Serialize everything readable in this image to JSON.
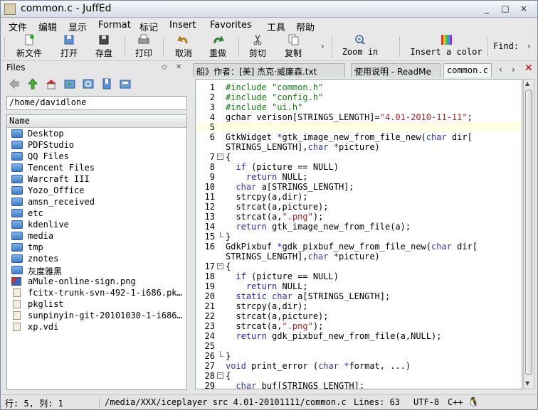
{
  "window": {
    "title": "common.c - JuffEd",
    "buttons": [
      "_",
      "□",
      "×"
    ]
  },
  "menu": [
    "文件",
    "编辑",
    "显示",
    "Format",
    "标记",
    "Insert",
    "Favorites",
    "工具",
    "帮助"
  ],
  "toolbar": {
    "new_label": "新文件",
    "open_label": "打开",
    "save_label": "存盘",
    "print_label": "打印",
    "undo_label": "取消",
    "redo_label": "重做",
    "cut_label": "剪切",
    "copy_label": "复制",
    "zoom_in_label": "Zoom in",
    "insert_color_label": "Insert a color",
    "find_label": "Find:",
    "more": "›"
  },
  "files_panel": {
    "title": "Files",
    "path": "/home/davidlone",
    "column": "Name",
    "items": [
      {
        "name": "Desktop",
        "kind": "folder"
      },
      {
        "name": "PDFStudio",
        "kind": "folder"
      },
      {
        "name": "QQ Files",
        "kind": "folder"
      },
      {
        "name": "Tencent Files",
        "kind": "folder"
      },
      {
        "name": "Warcraft III",
        "kind": "folder"
      },
      {
        "name": "Yozo_Office",
        "kind": "folder"
      },
      {
        "name": "amsn_received",
        "kind": "folder"
      },
      {
        "name": "etc",
        "kind": "folder"
      },
      {
        "name": "kdenlive",
        "kind": "folder"
      },
      {
        "name": "media",
        "kind": "folder"
      },
      {
        "name": "tmp",
        "kind": "folder"
      },
      {
        "name": "znotes",
        "kind": "folder"
      },
      {
        "name": "灰度雅黑",
        "kind": "folder"
      },
      {
        "name": "aMule-online-sign.png",
        "kind": "image"
      },
      {
        "name": "fcitx-trunk-svn-492-1-i686.pk…",
        "kind": "file"
      },
      {
        "name": "pkglist",
        "kind": "file"
      },
      {
        "name": "sunpinyin-git-20101030-1-i686…",
        "kind": "file"
      },
      {
        "name": "xp.vdi",
        "kind": "file"
      }
    ]
  },
  "tabs": [
    {
      "label": "船》作者：[美] 杰克·威廉森.txt"
    },
    {
      "label": "使用说明 - ReadMe"
    },
    {
      "label": "common.c"
    }
  ],
  "tab_nav": {
    "prev": "‹",
    "next": "›",
    "close": "✕"
  },
  "code": {
    "current_line": 5,
    "lines": [
      {
        "n": "1",
        "fold": "",
        "html": "<span class='pp'>#include \"common.h\"</span>"
      },
      {
        "n": "2",
        "fold": "",
        "html": "<span class='pp'>#include \"config.h\"</span>"
      },
      {
        "n": "3",
        "fold": "",
        "html": "<span class='pp'>#include \"ui.h\"</span>"
      },
      {
        "n": "4",
        "fold": "",
        "html": "gchar verison[STRINGS_LENGTH]=<span class='str'>\"4.01-2010-11-11\"</span>;"
      },
      {
        "n": "5",
        "fold": "",
        "html": ""
      },
      {
        "n": "6",
        "fold": "",
        "html": "GtkWidget <span class='kw'>*</span>gtk_image_new_from_file_new(<span class='ty'>char</span> dir["
      },
      {
        "n": "",
        "fold": "",
        "html": "STRINGS_LENGTH],<span class='ty'>char</span> <span class='kw'>*</span>picture)"
      },
      {
        "n": "7",
        "fold": "open",
        "html": "{"
      },
      {
        "n": "8",
        "fold": "",
        "html": "  <span class='kw'>if</span> (picture == NULL)"
      },
      {
        "n": "9",
        "fold": "",
        "html": "    <span class='kw'>return</span> NULL;"
      },
      {
        "n": "10",
        "fold": "",
        "html": "  <span class='ty'>char</span> a[STRINGS_LENGTH];"
      },
      {
        "n": "11",
        "fold": "",
        "html": "  strcpy(a,dir);"
      },
      {
        "n": "12",
        "fold": "",
        "html": "  strcat(a,picture);"
      },
      {
        "n": "13",
        "fold": "",
        "html": "  strcat(a,<span class='str'>\".png\"</span>);"
      },
      {
        "n": "14",
        "fold": "",
        "html": "  <span class='kw'>return</span> gtk_image_new_from_file(a);"
      },
      {
        "n": "15",
        "fold": "end",
        "html": "}"
      },
      {
        "n": "16",
        "fold": "",
        "html": "GdkPixbuf <span class='kw'>*</span>gdk_pixbuf_new_from_file_new(<span class='ty'>char</span> dir["
      },
      {
        "n": "",
        "fold": "",
        "html": "STRINGS_LENGTH],<span class='ty'>char</span> <span class='kw'>*</span>picture)"
      },
      {
        "n": "17",
        "fold": "open",
        "html": "{"
      },
      {
        "n": "18",
        "fold": "",
        "html": "  <span class='kw'>if</span> (picture == NULL)"
      },
      {
        "n": "19",
        "fold": "",
        "html": "    <span class='kw'>return</span> NULL;"
      },
      {
        "n": "20",
        "fold": "",
        "html": "  <span class='kw'>static</span> <span class='ty'>char</span> a[STRINGS_LENGTH];"
      },
      {
        "n": "21",
        "fold": "",
        "html": "  strcpy(a,dir);"
      },
      {
        "n": "22",
        "fold": "",
        "html": "  strcat(a,picture);"
      },
      {
        "n": "23",
        "fold": "",
        "html": "  strcat(a,<span class='str'>\".png\"</span>);"
      },
      {
        "n": "24",
        "fold": "",
        "html": "  <span class='kw'>return</span> gdk_pixbuf_new_from_file(a,NULL);"
      },
      {
        "n": "25",
        "fold": "",
        "html": ""
      },
      {
        "n": "26",
        "fold": "end",
        "html": "}"
      },
      {
        "n": "27",
        "fold": "",
        "html": "<span class='ty'>void</span> print_error (<span class='ty'>char</span> <span class='kw'>*</span>format, ...)"
      },
      {
        "n": "28",
        "fold": "open",
        "html": "{"
      },
      {
        "n": "29",
        "fold": "",
        "html": "  <span class='ty'>char</span> buf[STRINGS_LENGTH];"
      }
    ]
  },
  "status": {
    "position": "行: 5, 列: 1",
    "path": "/media/XXX/iceplayer src 4.01-20101111/common.c",
    "lines": "Lines: 63",
    "encoding": "UTF-8",
    "language": "C++"
  },
  "colors": {
    "keyword": "#2222cc",
    "preprocessor": "#108010",
    "string": "#b02020"
  },
  "icons": [
    "new-file-icon",
    "open-icon",
    "save-icon",
    "print-icon",
    "undo-icon",
    "redo-icon",
    "cut-icon",
    "copy-icon",
    "zoom-in-icon",
    "color-icon",
    "back-icon",
    "up-icon",
    "home-icon",
    "refresh-icon",
    "bookmark-icon",
    "folder-icon",
    "file-icon"
  ]
}
